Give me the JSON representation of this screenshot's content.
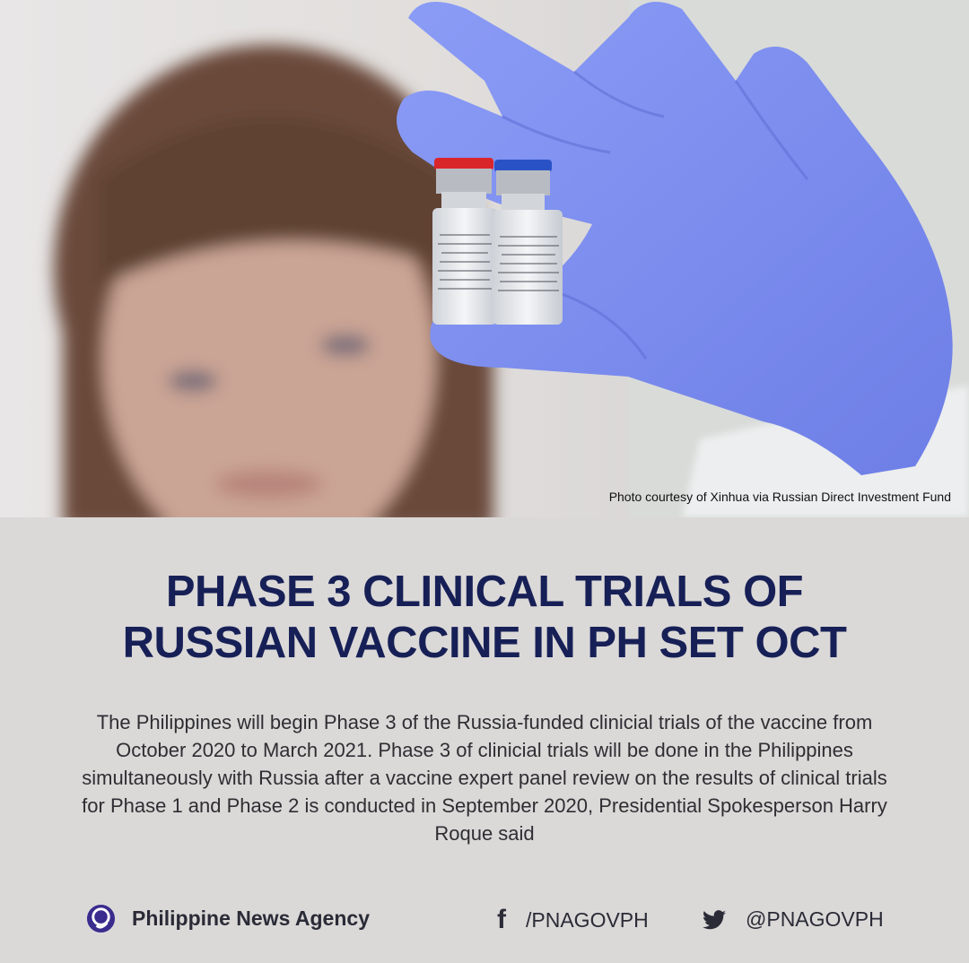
{
  "photo": {
    "caption": "Photo courtesy of Xinhua via Russian Direct Investment Fund"
  },
  "headline": {
    "line1": "PHASE 3 CLINICAL TRIALS OF",
    "line2": "RUSSIAN VACCINE IN PH SET OCT"
  },
  "body": {
    "text": "The Philippines will begin Phase 3 of the Russia-funded clinicial trials of the vaccine from October 2020 to March 2021. Phase 3 of clinicial trials will be done in the Philippines simultaneously with Russia after a vaccine expert panel review on the results of clinical trials for Phase 1 and Phase 2 is conducted in September 2020, Presidential Spokesperson Harry Roque said"
  },
  "footer": {
    "agency_name": "Philippine News Agency",
    "facebook_handle": "/PNAGOVPH",
    "twitter_handle": "@PNAGOVPH"
  },
  "colors": {
    "headline": "#172056",
    "background": "#dbd9d8",
    "glove": "#7d8ff0"
  },
  "icons": [
    "pna-logo-icon",
    "facebook-icon",
    "twitter-icon"
  ]
}
